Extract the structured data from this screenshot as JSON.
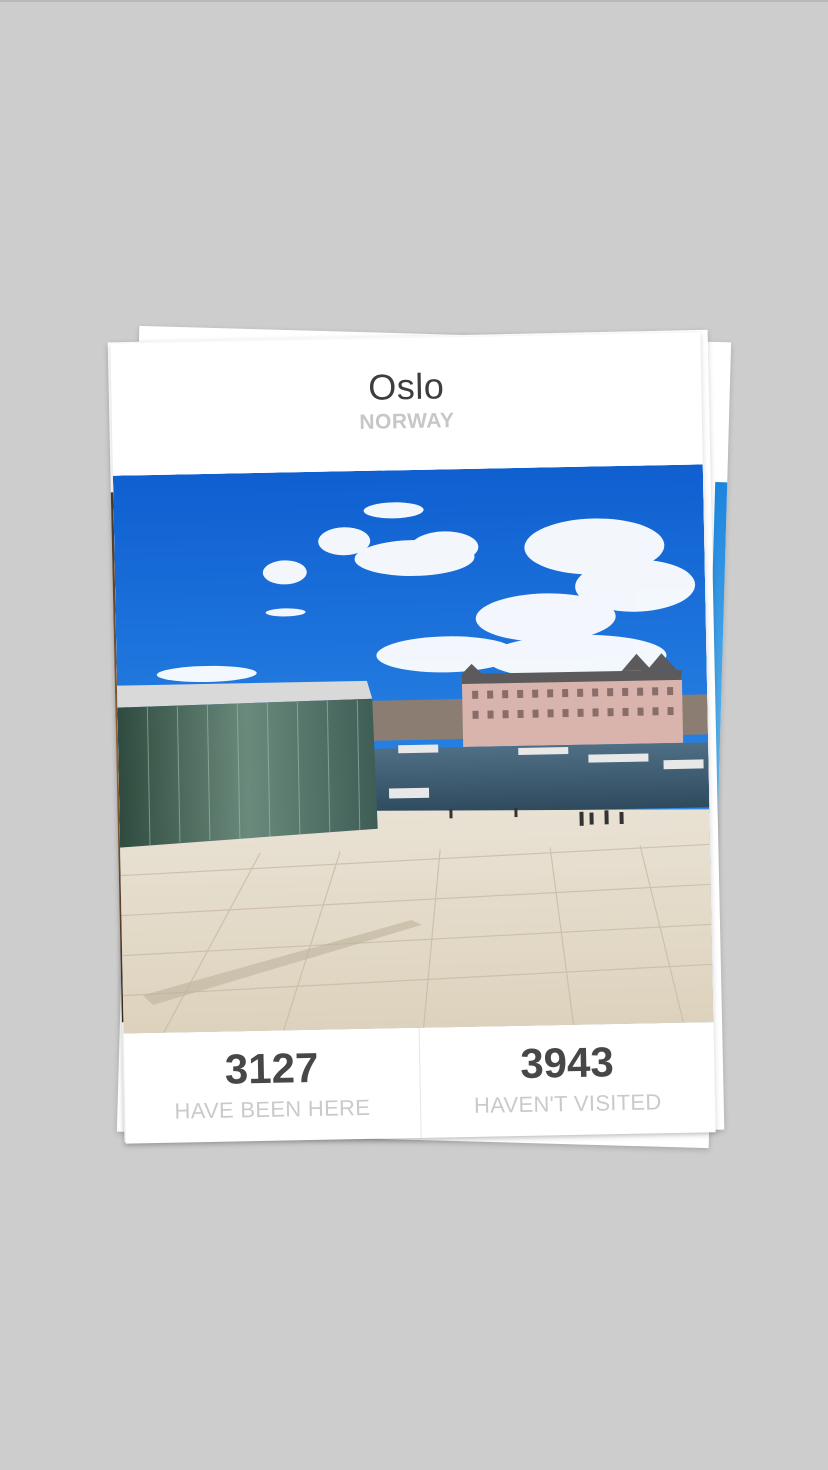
{
  "card": {
    "city": "Oslo",
    "country": "NORWAY",
    "stats": [
      {
        "value": "3127",
        "label": "HAVE BEEN HERE"
      },
      {
        "value": "3943",
        "label": "HAVEN'T VISITED"
      }
    ]
  },
  "colors": {
    "background": "#cdcdcd",
    "card": "#ffffff",
    "title_text": "#3d3d3d",
    "subtitle_text": "#c7c7c7",
    "stat_number": "#474747",
    "stat_label": "#cacaca",
    "sky": "#1b6fd6"
  }
}
